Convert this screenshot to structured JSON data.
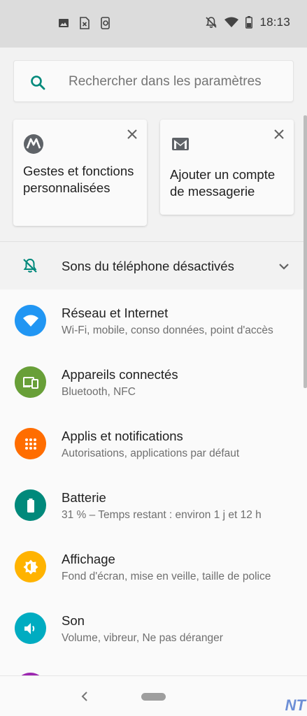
{
  "status_bar": {
    "time": "18:13",
    "left_icons": [
      "image-icon",
      "sim-error-icon",
      "screen-share-icon"
    ],
    "right_icons": [
      "notifications-off-icon",
      "wifi-icon",
      "battery-icon"
    ]
  },
  "search": {
    "placeholder": "Rechercher dans les paramètres"
  },
  "suggestions": [
    {
      "icon": "motorola-icon",
      "text": "Gestes et fonctions personnalisées"
    },
    {
      "icon": "gmail-icon",
      "text": "Ajouter un compte de messagerie"
    }
  ],
  "condition": {
    "icon": "notifications-off-icon",
    "text": "Sons du téléphone désactivés"
  },
  "settings": [
    {
      "title": "Réseau et Internet",
      "subtitle": "Wi-Fi, mobile, conso données, point d'accès",
      "icon": "wifi-icon",
      "color": "#2196f3"
    },
    {
      "title": "Appareils connectés",
      "subtitle": "Bluetooth, NFC",
      "icon": "devices-icon",
      "color": "#689f38"
    },
    {
      "title": "Applis et notifications",
      "subtitle": "Autorisations, applications par défaut",
      "icon": "apps-icon",
      "color": "#ff6d00"
    },
    {
      "title": "Batterie",
      "subtitle": "31 % – Temps restant : environ 1 j et 12 h",
      "icon": "battery-icon",
      "color": "#00897b"
    },
    {
      "title": "Affichage",
      "subtitle": "Fond d'écran, mise en veille, taille de police",
      "icon": "brightness-icon",
      "color": "#ffb300"
    },
    {
      "title": "Son",
      "subtitle": "Volume, vibreur, Ne pas déranger",
      "icon": "volume-icon",
      "color": "#00acc1"
    }
  ],
  "watermark": "NT"
}
